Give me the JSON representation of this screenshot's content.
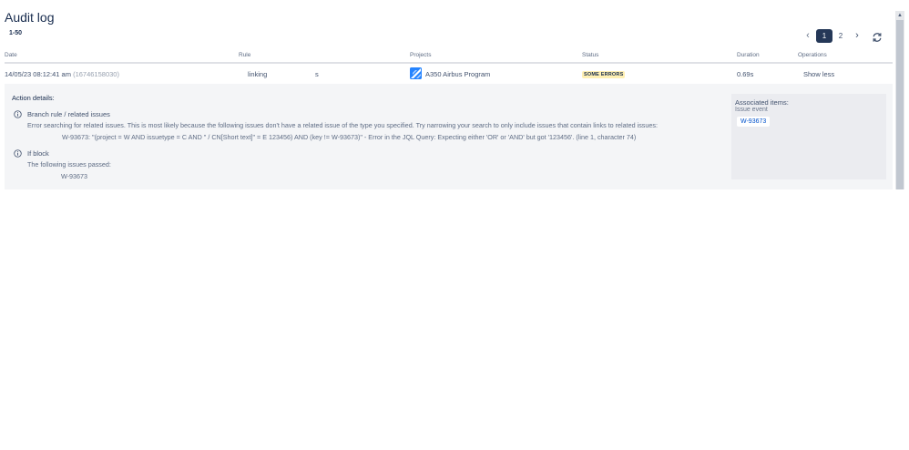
{
  "page": {
    "title": "Audit log",
    "range": "1-50"
  },
  "pagination": {
    "prev_icon": "chevron-left-icon",
    "pages": [
      "1",
      "2"
    ],
    "current": "1",
    "next_icon": "chevron-right-icon",
    "refresh_icon": "refresh-icon"
  },
  "table": {
    "headers": [
      "Date",
      "Rule",
      "Projects",
      "Status",
      "Duration",
      "Operations"
    ],
    "row": {
      "date": "14/05/23 08:12:41 am",
      "timestamp": "(16746158030)",
      "rule": "linking",
      "rule_extra": "s",
      "project": "A350 Airbus Program",
      "status": "SOME ERRORS",
      "duration": "0.69s",
      "operation": "Show less"
    }
  },
  "details": {
    "title": "Action details:",
    "block1": {
      "title": "Branch rule / related issues",
      "line1": "Error searching for related issues. This is most likely because the following issues don't have a related issue of the type you specified. Try narrowing your search to only include issues that contain links to related issues:",
      "line2": "W-93673: \"(project =    W AND issuetype =    C AND \"                    / CN[Short text]\" = E         123456) AND (key !=    W-93673)\" - Error in the JQL Query: Expecting either 'OR' or 'AND' but got '123456'. (line 1, character 74)"
    },
    "block2": {
      "title": "If block",
      "line1": "The following issues passed:",
      "issue": "W-93673"
    },
    "associated": {
      "title": "Associated items:",
      "subtitle": "Issue event",
      "item": "W-93673"
    }
  },
  "colors": {
    "accent": "#253858",
    "link": "#0052cc",
    "warning_badge": "#fff0b3",
    "panel": "#f4f5f7"
  }
}
